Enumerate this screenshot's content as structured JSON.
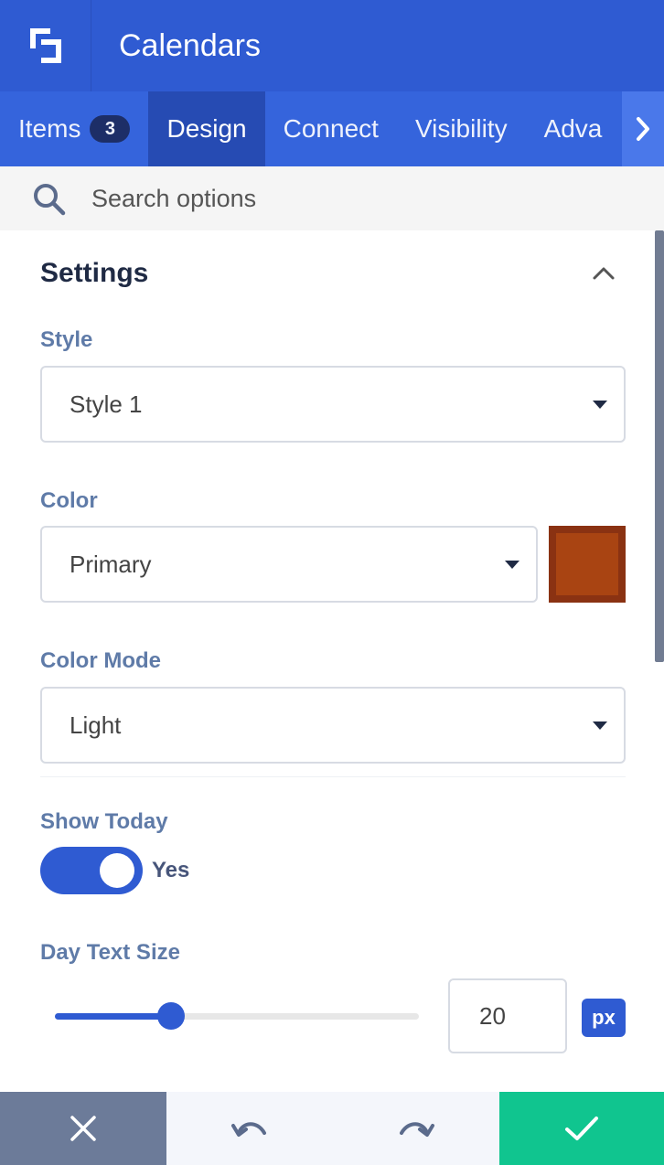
{
  "header": {
    "title": "Calendars",
    "logo_icon": "builder-logo-icon"
  },
  "tabs": [
    {
      "label": "Items",
      "badge": "3",
      "active": false
    },
    {
      "label": "Design",
      "active": true
    },
    {
      "label": "Connect",
      "active": false
    },
    {
      "label": "Visibility",
      "active": false
    },
    {
      "label": "Adva",
      "active": false
    }
  ],
  "search": {
    "placeholder": "Search options"
  },
  "section": {
    "title": "Settings"
  },
  "fields": {
    "style": {
      "label": "Style",
      "value": "Style 1"
    },
    "color": {
      "label": "Color",
      "value": "Primary",
      "swatch": "#a94412"
    },
    "color_mode": {
      "label": "Color Mode",
      "value": "Light"
    },
    "show_today": {
      "label": "Show Today",
      "value": "Yes",
      "on": true
    },
    "day_text_size": {
      "label": "Day Text Size",
      "value": "20",
      "unit": "px",
      "slider_fraction": 0.32
    }
  },
  "colors": {
    "primary": "#2f5bd2",
    "save": "#10c58f",
    "cancel": "#6c7b99"
  }
}
